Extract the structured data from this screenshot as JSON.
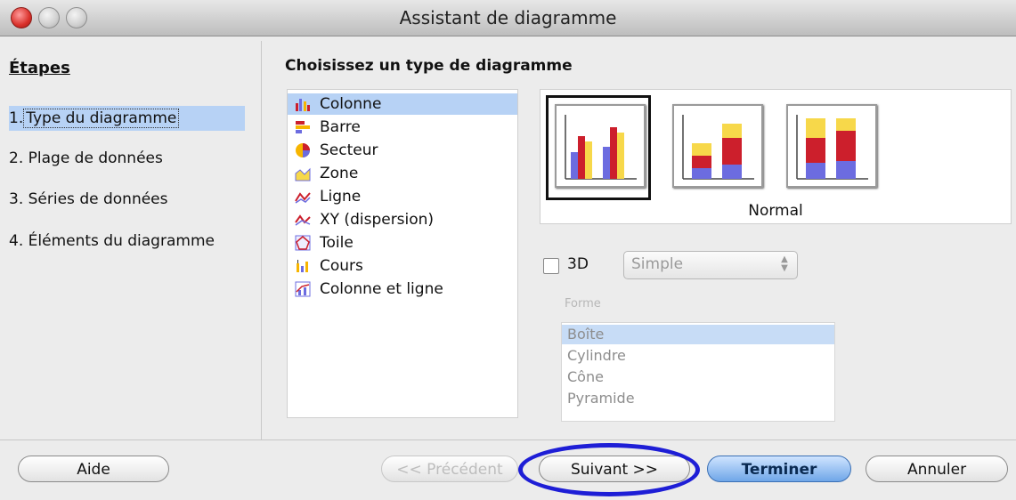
{
  "window": {
    "title": "Assistant de diagramme"
  },
  "steps": {
    "title": "Étapes",
    "items": [
      {
        "number": "1.",
        "label": "Type du diagramme"
      },
      {
        "number": "2.",
        "label": "Plage de données"
      },
      {
        "number": "3.",
        "label": "Séries de données"
      },
      {
        "number": "4.",
        "label": "Éléments du diagramme"
      }
    ]
  },
  "chart_type": {
    "title": "Choisissez un type de diagramme",
    "types": [
      {
        "label": "Colonne",
        "icon": "column-chart-icon"
      },
      {
        "label": "Barre",
        "icon": "bar-chart-icon"
      },
      {
        "label": "Secteur",
        "icon": "pie-chart-icon"
      },
      {
        "label": "Zone",
        "icon": "area-chart-icon"
      },
      {
        "label": "Ligne",
        "icon": "line-chart-icon"
      },
      {
        "label": "XY (dispersion)",
        "icon": "scatter-chart-icon"
      },
      {
        "label": "Toile",
        "icon": "net-chart-icon"
      },
      {
        "label": "Cours",
        "icon": "stock-chart-icon"
      },
      {
        "label": "Colonne et ligne",
        "icon": "column-line-chart-icon"
      }
    ],
    "selected_type": "Colonne",
    "variant_name": "Normal",
    "variants": [
      "normal-column-icon",
      "stacked-column-icon",
      "percent-stacked-column-icon"
    ]
  },
  "options": {
    "three_d_label": "3D",
    "three_d_checked": false,
    "three_d_style": "Simple",
    "shape_label": "Forme",
    "shapes": [
      "Boîte",
      "Cylindre",
      "Cône",
      "Pyramide"
    ],
    "selected_shape": "Boîte"
  },
  "buttons": {
    "help": "Aide",
    "previous": "<< Précédent",
    "next": "Suivant >>",
    "finish": "Terminer",
    "cancel": "Annuler"
  },
  "colors": {
    "selection": "#b7d2f5",
    "annotation": "#1e1ed6",
    "bar_blue": "#6c6ce0",
    "bar_red": "#cc1f2c",
    "bar_yellow": "#f7d84a"
  }
}
